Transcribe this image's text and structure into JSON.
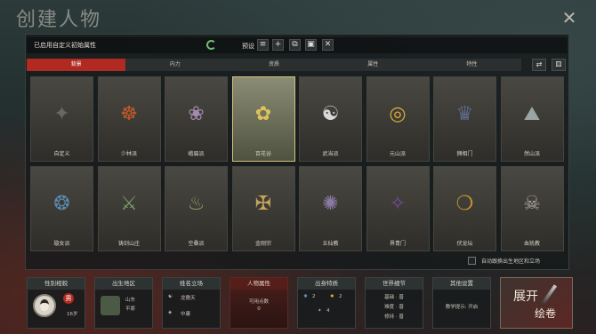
{
  "window": {
    "title": "创建人物"
  },
  "topbar": {
    "custom_attr_label": "已启用自定义初始属性",
    "preset_label": "预设",
    "preset_buttons": [
      "≡",
      "+",
      "⧉",
      "▣",
      "✕"
    ]
  },
  "tabs": [
    {
      "label": "背景",
      "active": true
    },
    {
      "label": "内力",
      "active": false
    },
    {
      "label": "资质",
      "active": false
    },
    {
      "label": "属性",
      "active": false
    },
    {
      "label": "特性",
      "active": false
    }
  ],
  "sects": [
    {
      "name": "自定义",
      "icon": "custom-icon",
      "glyph": "✦",
      "color": "#6a6862"
    },
    {
      "name": "少林派",
      "icon": "flame-beads-icon",
      "glyph": "☸",
      "color": "#c25a2a"
    },
    {
      "name": "峨眉派",
      "icon": "lotus-icon",
      "glyph": "❀",
      "color": "#a58ab0"
    },
    {
      "name": "百花谷",
      "icon": "golden-flower-icon",
      "glyph": "✿",
      "color": "#e0c25a",
      "selected": true
    },
    {
      "name": "武当派",
      "icon": "taiji-icon",
      "glyph": "☯",
      "color": "#d8d8d8"
    },
    {
      "name": "元山派",
      "icon": "golden-ring-icon",
      "glyph": "◎",
      "color": "#d6a83a"
    },
    {
      "name": "狮相门",
      "icon": "lion-head-icon",
      "glyph": "♛",
      "color": "#5e6a8a"
    },
    {
      "name": "然山派",
      "icon": "mountain-cloud-icon",
      "glyph": "⛰",
      "color": "#9aa6a6"
    },
    {
      "name": "璇女派",
      "icon": "swirl-orb-icon",
      "glyph": "❂",
      "color": "#5a8ab0"
    },
    {
      "name": "铸剑山庄",
      "icon": "sword-cauldron-icon",
      "glyph": "⚔",
      "color": "#7a9a6a"
    },
    {
      "name": "空桑派",
      "icon": "tripod-cauldron-icon",
      "glyph": "♨",
      "color": "#8a9a6a"
    },
    {
      "name": "金刚宗",
      "icon": "vajra-icon",
      "glyph": "✠",
      "color": "#c8a45a"
    },
    {
      "name": "五仙教",
      "icon": "scorpion-icon",
      "glyph": "✺",
      "color": "#8a7aa6"
    },
    {
      "name": "界青门",
      "icon": "blade-serpent-icon",
      "glyph": "✧",
      "color": "#7a4aa0"
    },
    {
      "name": "伏龙坛",
      "icon": "dragon-ring-icon",
      "glyph": "❍",
      "color": "#c8962a"
    },
    {
      "name": "血犼教",
      "icon": "beast-head-icon",
      "glyph": "☠",
      "color": "#b0a8a0"
    }
  ],
  "checkbox_label": "自动跟换出生地区和立场",
  "bottom": {
    "gender": {
      "title": "性别相貌",
      "age": "16岁",
      "sex": "男"
    },
    "birthplace": {
      "title": "出生地区",
      "line1": "山东",
      "line2": "平原"
    },
    "surname": {
      "title": "姓名立场",
      "name": "龙傲天",
      "stance": "中庸"
    },
    "attributes": {
      "title": "人物属性",
      "line1": "可用点数",
      "points": "0"
    },
    "origin": {
      "title": "出身特质",
      "v1": "2",
      "v2": "2",
      "v3": "4"
    },
    "world": {
      "title": "世界细节",
      "l1": "基础 · 普",
      "l2": "难度 · 普",
      "l3": "修持 · 普"
    },
    "other": {
      "title": "其他设置",
      "text": "教学提示: 开启"
    },
    "expand": {
      "line1": "展开",
      "line2": "绘卷"
    }
  }
}
